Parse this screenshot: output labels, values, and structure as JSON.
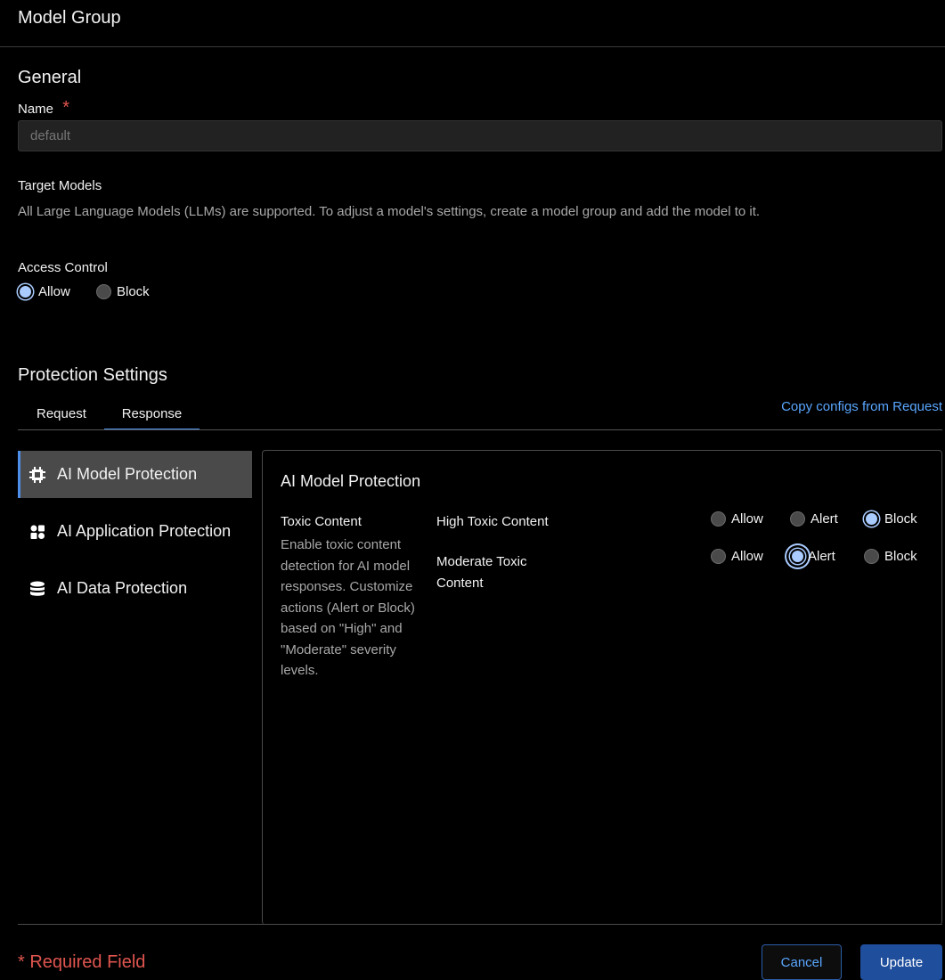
{
  "header": {
    "title": "Model Group"
  },
  "general": {
    "heading": "General",
    "name_label": "Name",
    "required_mark": "*",
    "name_placeholder": "default",
    "target_models_label": "Target Models",
    "target_models_desc": "All Large Language Models (LLMs) are supported. To adjust a model's settings, create a model group and add the model to it.",
    "access_control_label": "Access Control",
    "access_options": [
      {
        "label": "Allow",
        "selected": true
      },
      {
        "label": "Block",
        "selected": false
      }
    ]
  },
  "protection": {
    "heading": "Protection Settings",
    "tabs": [
      {
        "label": "Request",
        "active": false
      },
      {
        "label": "Response",
        "active": true
      }
    ],
    "copy_link": "Copy configs from Request",
    "sidebar": [
      {
        "label": "AI Model Protection",
        "icon": "chip-icon",
        "active": true
      },
      {
        "label": "AI Application Protection",
        "icon": "apps-icon",
        "active": false
      },
      {
        "label": "AI Data Protection",
        "icon": "database-icon",
        "active": false
      }
    ],
    "panel": {
      "title": "AI Model Protection",
      "section_title": "Toxic Content",
      "section_desc": "Enable toxic content detection for AI model responses. Customize actions (Alert or Block) based on \"High\" and \"Moderate\" severity levels.",
      "rows": [
        {
          "label": "High Toxic Content",
          "options": [
            "Allow",
            "Alert",
            "Block"
          ],
          "selected": "Block"
        },
        {
          "label": "Moderate Toxic Content",
          "options": [
            "Allow",
            "Alert",
            "Block"
          ],
          "selected": "Alert"
        }
      ]
    }
  },
  "footer": {
    "required_mark": "*",
    "required_text": "Required Field",
    "cancel": "Cancel",
    "update": "Update"
  },
  "colors": {
    "accent": "#4d8fe8",
    "link": "#5aa6ff",
    "required": "#e0554f",
    "primary_button": "#1f4e9c"
  }
}
